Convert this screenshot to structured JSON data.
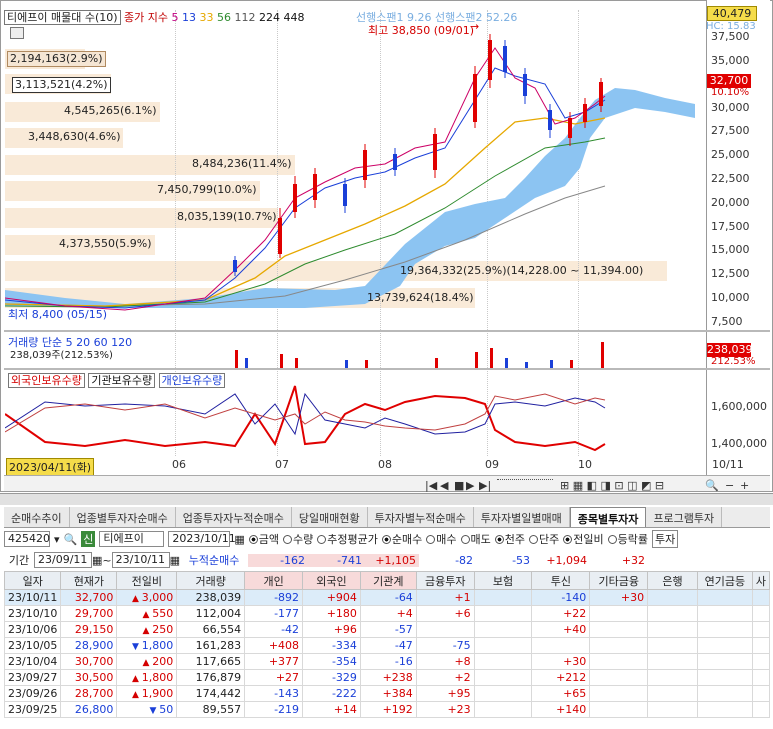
{
  "chart": {
    "title": "티에프이 매물대 수(10)",
    "ma_label": "종가 지수",
    "ma_periods": [
      "5",
      "13",
      "33",
      "56",
      "112",
      "224",
      "448"
    ],
    "leading_spans": "선행스팬1 9.26 선행스팬2 52.26",
    "hc_label": "HC: 15.83",
    "top_box": "40,479",
    "high_label": "최고 38,850 (09/01)",
    "low_label": "최저 8,400 (05/15)",
    "current_price_box": "32,700",
    "current_pct": "10.10%",
    "y_ticks": [
      "37,500",
      "35,000",
      "32,500",
      "30,000",
      "27,500",
      "25,000",
      "22,500",
      "20,000",
      "17,500",
      "15,000",
      "12,500",
      "10,000",
      "7,500"
    ],
    "volume_profile": [
      "2,194,163(2.9%)",
      "3,113,521(4.2%)",
      "4,545,265(6.1%)",
      "3,448,630(4.6%)",
      "8,484,236(11.4%)",
      "7,450,799(10.0%)",
      "8,035,139(10.7%)",
      "4,373,550(5.9%)",
      "19,364,332(25.9%)(14,228.00 ~ 11,394.00)",
      "13,739,624(18.4%)"
    ],
    "volume_header": "거래량 단순 5 20 60 120",
    "volume_value": "238,039주(212.53%)",
    "volume_box": "238,039",
    "volume_pct": "212.53%",
    "holder_header": [
      "외국인보유수량",
      "기관보유수량",
      "개인보유수량"
    ],
    "holder_ticks": [
      "1,600,000",
      "1,400,000"
    ],
    "date_badge": "2023/04/11(화)",
    "x_ticks": [
      "06",
      "07",
      "08",
      "09",
      "10"
    ],
    "x_end": "10/11",
    "colors": {
      "red": "#e00000",
      "blue": "#1a3fd8",
      "cloud": "#8cc4f2"
    }
  },
  "tabs": [
    "순매수추이",
    "업종별투자자순매수",
    "업종투자자누적순매수",
    "당일매매현황",
    "투자자별누적순매수",
    "투자자별일별매매",
    "종목별투자자",
    "프로그램투자"
  ],
  "active_tab": "종목별투자자",
  "controls": {
    "code": "425420",
    "stock_name": "티에프이",
    "date": "2023/10/11",
    "opts1": [
      "금액",
      "수량",
      "추정평균가"
    ],
    "opts2": [
      "순매수",
      "매수",
      "매도"
    ],
    "opts3": [
      "천주",
      "단주"
    ],
    "opts4": [
      "전일비",
      "등락률"
    ],
    "extra": "투자",
    "period_label": "기간",
    "period_from": "23/09/11",
    "period_to": "23/10/11",
    "cumulative_label": "누적순매수",
    "cumulative": [
      "-162",
      "-741",
      "+1,105",
      "-82",
      "-53",
      "+1,094",
      "+32"
    ]
  },
  "table": {
    "headers": [
      "일자",
      "현재가",
      "전일비",
      "거래량",
      "개인",
      "외국인",
      "기관계",
      "금융투자",
      "보험",
      "투신",
      "기타금융",
      "은행",
      "연기금등",
      "사"
    ],
    "rows": [
      {
        "date": "23/10/11",
        "price": "32,700",
        "dir": "up",
        "change": "3,000",
        "volume": "238,039",
        "individual": "-892",
        "foreign": "+904",
        "inst": "-64",
        "fin": "+1",
        "ins": "",
        "trust": "-140",
        "otherfin": "+30",
        "bank": "",
        "pension": ""
      },
      {
        "date": "23/10/10",
        "price": "29,700",
        "dir": "up",
        "change": "550",
        "volume": "112,004",
        "individual": "-177",
        "foreign": "+180",
        "inst": "+4",
        "fin": "+6",
        "ins": "",
        "trust": "+22",
        "otherfin": "",
        "bank": "",
        "pension": ""
      },
      {
        "date": "23/10/06",
        "price": "29,150",
        "dir": "up",
        "change": "250",
        "volume": "66,554",
        "individual": "-42",
        "foreign": "+96",
        "inst": "-57",
        "fin": "",
        "ins": "",
        "trust": "+40",
        "otherfin": "",
        "bank": "",
        "pension": ""
      },
      {
        "date": "23/10/05",
        "price": "28,900",
        "dir": "down",
        "change": "1,800",
        "volume": "161,283",
        "individual": "+408",
        "foreign": "-334",
        "inst": "-47",
        "fin": "-75",
        "ins": "",
        "trust": "",
        "otherfin": "",
        "bank": "",
        "pension": ""
      },
      {
        "date": "23/10/04",
        "price": "30,700",
        "dir": "up",
        "change": "200",
        "volume": "117,665",
        "individual": "+377",
        "foreign": "-354",
        "inst": "-16",
        "fin": "+8",
        "ins": "",
        "trust": "+30",
        "otherfin": "",
        "bank": "",
        "pension": ""
      },
      {
        "date": "23/09/27",
        "price": "30,500",
        "dir": "up",
        "change": "1,800",
        "volume": "176,879",
        "individual": "+27",
        "foreign": "-329",
        "inst": "+238",
        "fin": "+2",
        "ins": "",
        "trust": "+212",
        "otherfin": "",
        "bank": "",
        "pension": ""
      },
      {
        "date": "23/09/26",
        "price": "28,700",
        "dir": "up",
        "change": "1,900",
        "volume": "174,442",
        "individual": "-143",
        "foreign": "-222",
        "inst": "+384",
        "fin": "+95",
        "ins": "",
        "trust": "+65",
        "otherfin": "",
        "bank": "",
        "pension": ""
      },
      {
        "date": "23/09/25",
        "price": "26,800",
        "dir": "down",
        "change": "50",
        "volume": "89,557",
        "individual": "-219",
        "foreign": "+14",
        "inst": "+192",
        "fin": "+23",
        "ins": "",
        "trust": "+140",
        "otherfin": "",
        "bank": "",
        "pension": ""
      }
    ]
  }
}
